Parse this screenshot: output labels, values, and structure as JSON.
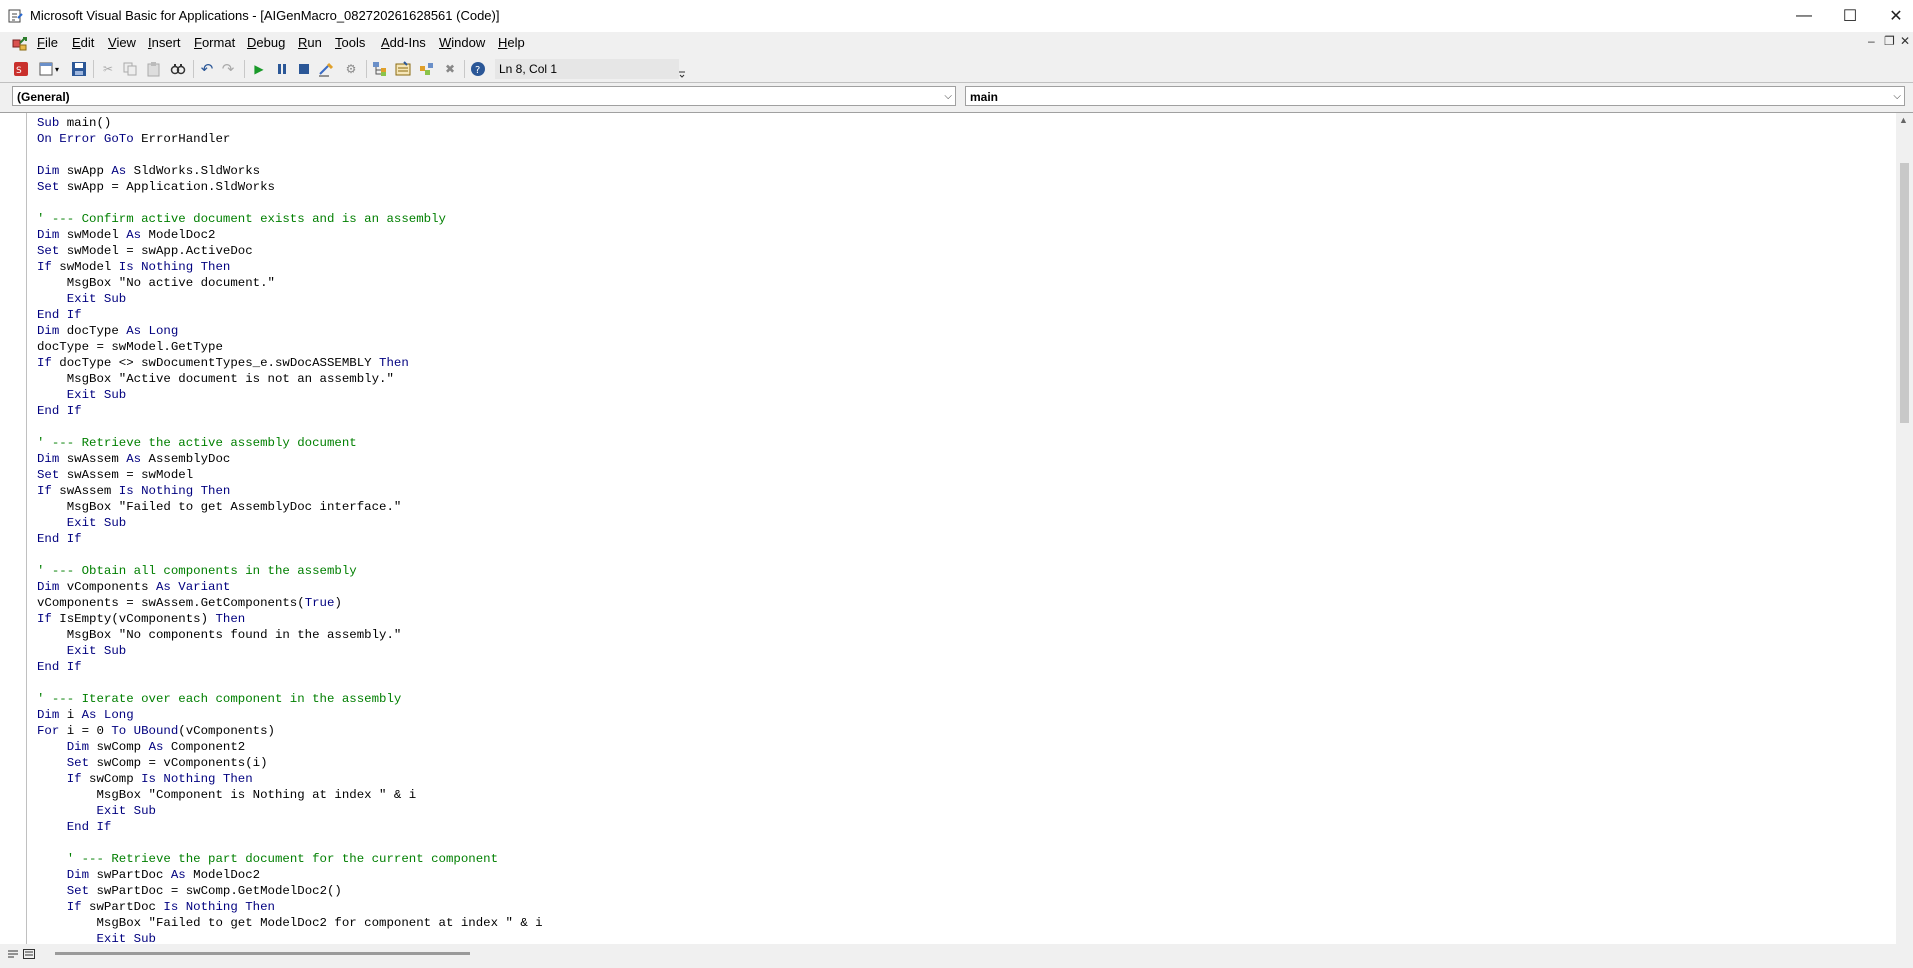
{
  "window": {
    "title": "Microsoft Visual Basic for Applications - [AIGenMacro_082720261628561 (Code)]",
    "minimize_icon": "—",
    "maximize_icon": "☐",
    "close_icon": "✕"
  },
  "menu": {
    "items": [
      "File",
      "Edit",
      "View",
      "Insert",
      "Format",
      "Debug",
      "Run",
      "Tools",
      "Add-Ins",
      "Window",
      "Help"
    ],
    "mdi_minimize": "–",
    "mdi_restore": "❐",
    "mdi_close": "✕"
  },
  "toolbar": {
    "position_text": "Ln 8, Col 1",
    "icons": [
      "solidworks-icon",
      "view-object-icon",
      "save-icon",
      "cut-icon",
      "copy-icon",
      "paste-icon",
      "find-icon",
      "undo-icon",
      "redo-icon",
      "run-icon",
      "break-icon",
      "reset-icon",
      "design-mode-icon",
      "project-explorer-icon",
      "properties-icon",
      "object-browser-icon",
      "toolbox-icon",
      "help-icon"
    ]
  },
  "combos": {
    "object": "(General)",
    "procedure": "main"
  },
  "code_lines": [
    [
      [
        "k",
        "Sub"
      ],
      [
        "t",
        " main()"
      ]
    ],
    [
      [
        "k",
        "On Error GoTo"
      ],
      [
        "t",
        " ErrorHandler"
      ]
    ],
    [],
    [
      [
        "k",
        "Dim"
      ],
      [
        "t",
        " swApp "
      ],
      [
        "k",
        "As"
      ],
      [
        "t",
        " SldWorks.SldWorks"
      ]
    ],
    [
      [
        "k",
        "Set"
      ],
      [
        "t",
        " swApp = Application.SldWorks"
      ]
    ],
    [],
    [
      [
        "c",
        "' --- Confirm active document exists and is an assembly"
      ]
    ],
    [
      [
        "k",
        "Dim"
      ],
      [
        "t",
        " swModel "
      ],
      [
        "k",
        "As"
      ],
      [
        "t",
        " ModelDoc2"
      ]
    ],
    [
      [
        "k",
        "Set"
      ],
      [
        "t",
        " swModel = swApp.ActiveDoc"
      ]
    ],
    [
      [
        "k",
        "If"
      ],
      [
        "t",
        " swModel "
      ],
      [
        "k",
        "Is Nothing Then"
      ]
    ],
    [
      [
        "t",
        "    MsgBox \"No active document.\""
      ]
    ],
    [
      [
        "t",
        "    "
      ],
      [
        "k",
        "Exit Sub"
      ]
    ],
    [
      [
        "k",
        "End If"
      ]
    ],
    [
      [
        "k",
        "Dim"
      ],
      [
        "t",
        " docType "
      ],
      [
        "k",
        "As Long"
      ]
    ],
    [
      [
        "t",
        "docType = swModel.GetType"
      ]
    ],
    [
      [
        "k",
        "If"
      ],
      [
        "t",
        " docType <> swDocumentTypes_e.swDocASSEMBLY "
      ],
      [
        "k",
        "Then"
      ]
    ],
    [
      [
        "t",
        "    MsgBox \"Active document is not an assembly.\""
      ]
    ],
    [
      [
        "t",
        "    "
      ],
      [
        "k",
        "Exit Sub"
      ]
    ],
    [
      [
        "k",
        "End If"
      ]
    ],
    [],
    [
      [
        "c",
        "' --- Retrieve the active assembly document"
      ]
    ],
    [
      [
        "k",
        "Dim"
      ],
      [
        "t",
        " swAssem "
      ],
      [
        "k",
        "As"
      ],
      [
        "t",
        " AssemblyDoc"
      ]
    ],
    [
      [
        "k",
        "Set"
      ],
      [
        "t",
        " swAssem = swModel"
      ]
    ],
    [
      [
        "k",
        "If"
      ],
      [
        "t",
        " swAssem "
      ],
      [
        "k",
        "Is Nothing Then"
      ]
    ],
    [
      [
        "t",
        "    MsgBox \"Failed to get AssemblyDoc interface.\""
      ]
    ],
    [
      [
        "t",
        "    "
      ],
      [
        "k",
        "Exit Sub"
      ]
    ],
    [
      [
        "k",
        "End If"
      ]
    ],
    [],
    [
      [
        "c",
        "' --- Obtain all components in the assembly"
      ]
    ],
    [
      [
        "k",
        "Dim"
      ],
      [
        "t",
        " vComponents "
      ],
      [
        "k",
        "As Variant"
      ]
    ],
    [
      [
        "t",
        "vComponents = swAssem.GetComponents("
      ],
      [
        "k",
        "True"
      ],
      [
        "t",
        ")"
      ]
    ],
    [
      [
        "k",
        "If"
      ],
      [
        "t",
        " IsEmpty(vComponents) "
      ],
      [
        "k",
        "Then"
      ]
    ],
    [
      [
        "t",
        "    MsgBox \"No components found in the assembly.\""
      ]
    ],
    [
      [
        "t",
        "    "
      ],
      [
        "k",
        "Exit Sub"
      ]
    ],
    [
      [
        "k",
        "End If"
      ]
    ],
    [],
    [
      [
        "c",
        "' --- Iterate over each component in the assembly"
      ]
    ],
    [
      [
        "k",
        "Dim"
      ],
      [
        "t",
        " i "
      ],
      [
        "k",
        "As Long"
      ]
    ],
    [
      [
        "k",
        "For"
      ],
      [
        "t",
        " i = 0 "
      ],
      [
        "k",
        "To UBound"
      ],
      [
        "t",
        "(vComponents)"
      ]
    ],
    [
      [
        "t",
        "    "
      ],
      [
        "k",
        "Dim"
      ],
      [
        "t",
        " swComp "
      ],
      [
        "k",
        "As"
      ],
      [
        "t",
        " Component2"
      ]
    ],
    [
      [
        "t",
        "    "
      ],
      [
        "k",
        "Set"
      ],
      [
        "t",
        " swComp = vComponents(i)"
      ]
    ],
    [
      [
        "t",
        "    "
      ],
      [
        "k",
        "If"
      ],
      [
        "t",
        " swComp "
      ],
      [
        "k",
        "Is Nothing Then"
      ]
    ],
    [
      [
        "t",
        "        MsgBox \"Component is Nothing at index \" & i"
      ]
    ],
    [
      [
        "t",
        "        "
      ],
      [
        "k",
        "Exit Sub"
      ]
    ],
    [
      [
        "t",
        "    "
      ],
      [
        "k",
        "End If"
      ]
    ],
    [],
    [
      [
        "t",
        "    "
      ],
      [
        "c",
        "' --- Retrieve the part document for the current component"
      ]
    ],
    [
      [
        "t",
        "    "
      ],
      [
        "k",
        "Dim"
      ],
      [
        "t",
        " swPartDoc "
      ],
      [
        "k",
        "As"
      ],
      [
        "t",
        " ModelDoc2"
      ]
    ],
    [
      [
        "t",
        "    "
      ],
      [
        "k",
        "Set"
      ],
      [
        "t",
        " swPartDoc = swComp.GetModelDoc2()"
      ]
    ],
    [
      [
        "t",
        "    "
      ],
      [
        "k",
        "If"
      ],
      [
        "t",
        " swPartDoc "
      ],
      [
        "k",
        "Is Nothing Then"
      ]
    ],
    [
      [
        "t",
        "        MsgBox \"Failed to get ModelDoc2 for component at index \" & i"
      ]
    ],
    [
      [
        "t",
        "        "
      ],
      [
        "k",
        "Exit Sub"
      ]
    ]
  ]
}
